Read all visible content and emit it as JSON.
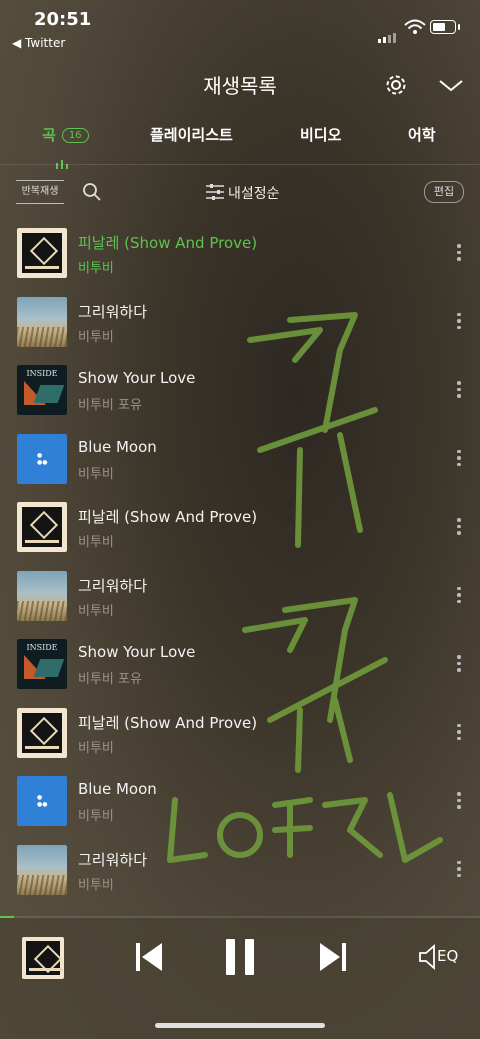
{
  "status": {
    "time": "20:51",
    "back_label": "◀ Twitter"
  },
  "header": {
    "title": "재생목록"
  },
  "tabs": [
    {
      "label": "곡",
      "badge": "16"
    },
    {
      "label": "플레이리스트"
    },
    {
      "label": "비디오"
    },
    {
      "label": "어학"
    }
  ],
  "toolbar": {
    "repeat_label": "반복재생",
    "sort_label": "내설정순",
    "edit_label": "편집"
  },
  "songs": [
    {
      "title": "피날레 (Show And Prove)",
      "artist": "비투비",
      "art": "finale",
      "playing": true
    },
    {
      "title": "그리워하다",
      "artist": "비투비",
      "art": "missing"
    },
    {
      "title": "Show Your Love",
      "artist": "비투비 포유",
      "art": "inside"
    },
    {
      "title": "Blue Moon",
      "artist": "비투비",
      "art": "bluemoon"
    },
    {
      "title": "피날레 (Show And Prove)",
      "artist": "비투비",
      "art": "finale"
    },
    {
      "title": "그리워하다",
      "artist": "비투비",
      "art": "missing"
    },
    {
      "title": "Show Your Love",
      "artist": "비투비 포유",
      "art": "inside"
    },
    {
      "title": "피날레 (Show And Prove)",
      "artist": "비투비",
      "art": "finale"
    },
    {
      "title": "Blue Moon",
      "artist": "비투비",
      "art": "bluemoon"
    },
    {
      "title": "그리워하다",
      "artist": "비투비",
      "art": "missing"
    }
  ],
  "player": {
    "eq_label": "EQ",
    "progress": 0.03
  },
  "art_text": {
    "inside": "INSIDE"
  },
  "colors": {
    "accent": "#5ec34f",
    "scribble": "#6f9a3c"
  },
  "icons": [
    "gear-icon",
    "chevron-down-icon",
    "search-icon",
    "sort-icon",
    "more-icon",
    "previous-icon",
    "pause-icon",
    "next-icon",
    "eq-icon"
  ]
}
